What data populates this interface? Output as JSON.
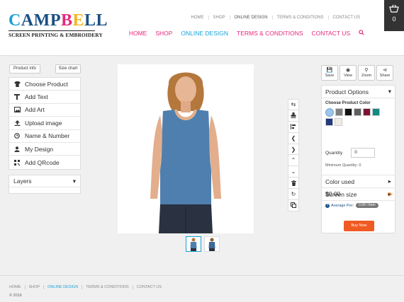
{
  "logo": {
    "p1": "C",
    "p2": "AMP",
    "p3": "B",
    "p4": "E",
    "p5": "LL",
    "subtitle": "SCREEN PRINTING & EMBROIDERY"
  },
  "top_nav": [
    "HOME",
    "SHOP",
    "ONLINE DESIGN",
    "TERMS & CONDITIONS",
    "CONTACT US"
  ],
  "main_nav": [
    "HOME",
    "SHOP",
    "ONLINE DESIGN",
    "TERMS & CONDITIONS",
    "CONTACT US"
  ],
  "active_nav": "ONLINE DESIGN",
  "cart": {
    "count": "0"
  },
  "left": {
    "product_info": "Product info",
    "size_chart": "Size chart",
    "tools": [
      {
        "label": "Choose Product",
        "icon": "tshirt-icon"
      },
      {
        "label": "Add Text",
        "icon": "text-icon"
      },
      {
        "label": "Add Art",
        "icon": "image-icon"
      },
      {
        "label": "Upload image",
        "icon": "upload-icon"
      },
      {
        "label": "Name & Number",
        "icon": "clock-icon"
      },
      {
        "label": "My Design",
        "icon": "user-icon"
      },
      {
        "label": "Add QRcode",
        "icon": "qrcode-icon"
      }
    ],
    "layers_label": "Layers"
  },
  "actions": {
    "save": "Save",
    "view": "View",
    "zoom": "Zoom",
    "share": "Share"
  },
  "right_panel": {
    "product_options": "Product Options",
    "choose_color": "Choose Product Color",
    "colors": [
      "#9fc5e8",
      "#7f7f7f",
      "#111111",
      "#5f5f5f",
      "#7a1530",
      "#138a82",
      "#233a7a",
      "#f1ede6"
    ],
    "selected_color": "#9fc5e8",
    "quantity_label": "Quantity",
    "quantity_value": "0",
    "min_quantity": "Minimum Quantity: 0",
    "color_used": "Color used",
    "screen_size": "Screen size",
    "price": "$0.00",
    "average_label": "Average Per:",
    "average_value": "0.00 / Item",
    "buy_now": "Buy Now"
  },
  "footer": {
    "nav": [
      "HOME",
      "SHOP",
      "ONLINE DESIGN",
      "TERMS & CONDITIONS",
      "CONTACT US"
    ],
    "copyright": "© 2016"
  }
}
